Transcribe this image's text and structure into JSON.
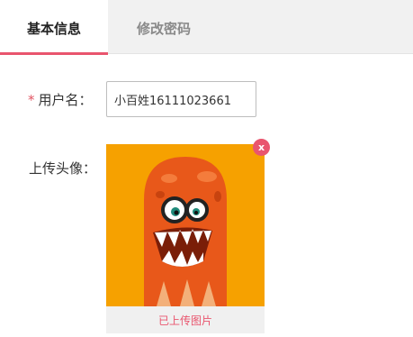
{
  "tabs": {
    "basic_info": "基本信息",
    "change_password": "修改密码"
  },
  "form": {
    "required_mark": "*",
    "username_label": "用户名：",
    "username_value": "小百姓16111023661",
    "avatar_label": "上传头像：",
    "uploaded_text": "已上传图片",
    "remove_glyph": "x"
  },
  "colors": {
    "accent": "#e9556e",
    "avatar_background": "#f6a100",
    "monster_body": "#e8581a"
  },
  "icons": {
    "avatar": "orange-monster-avatar",
    "remove": "close-icon"
  }
}
